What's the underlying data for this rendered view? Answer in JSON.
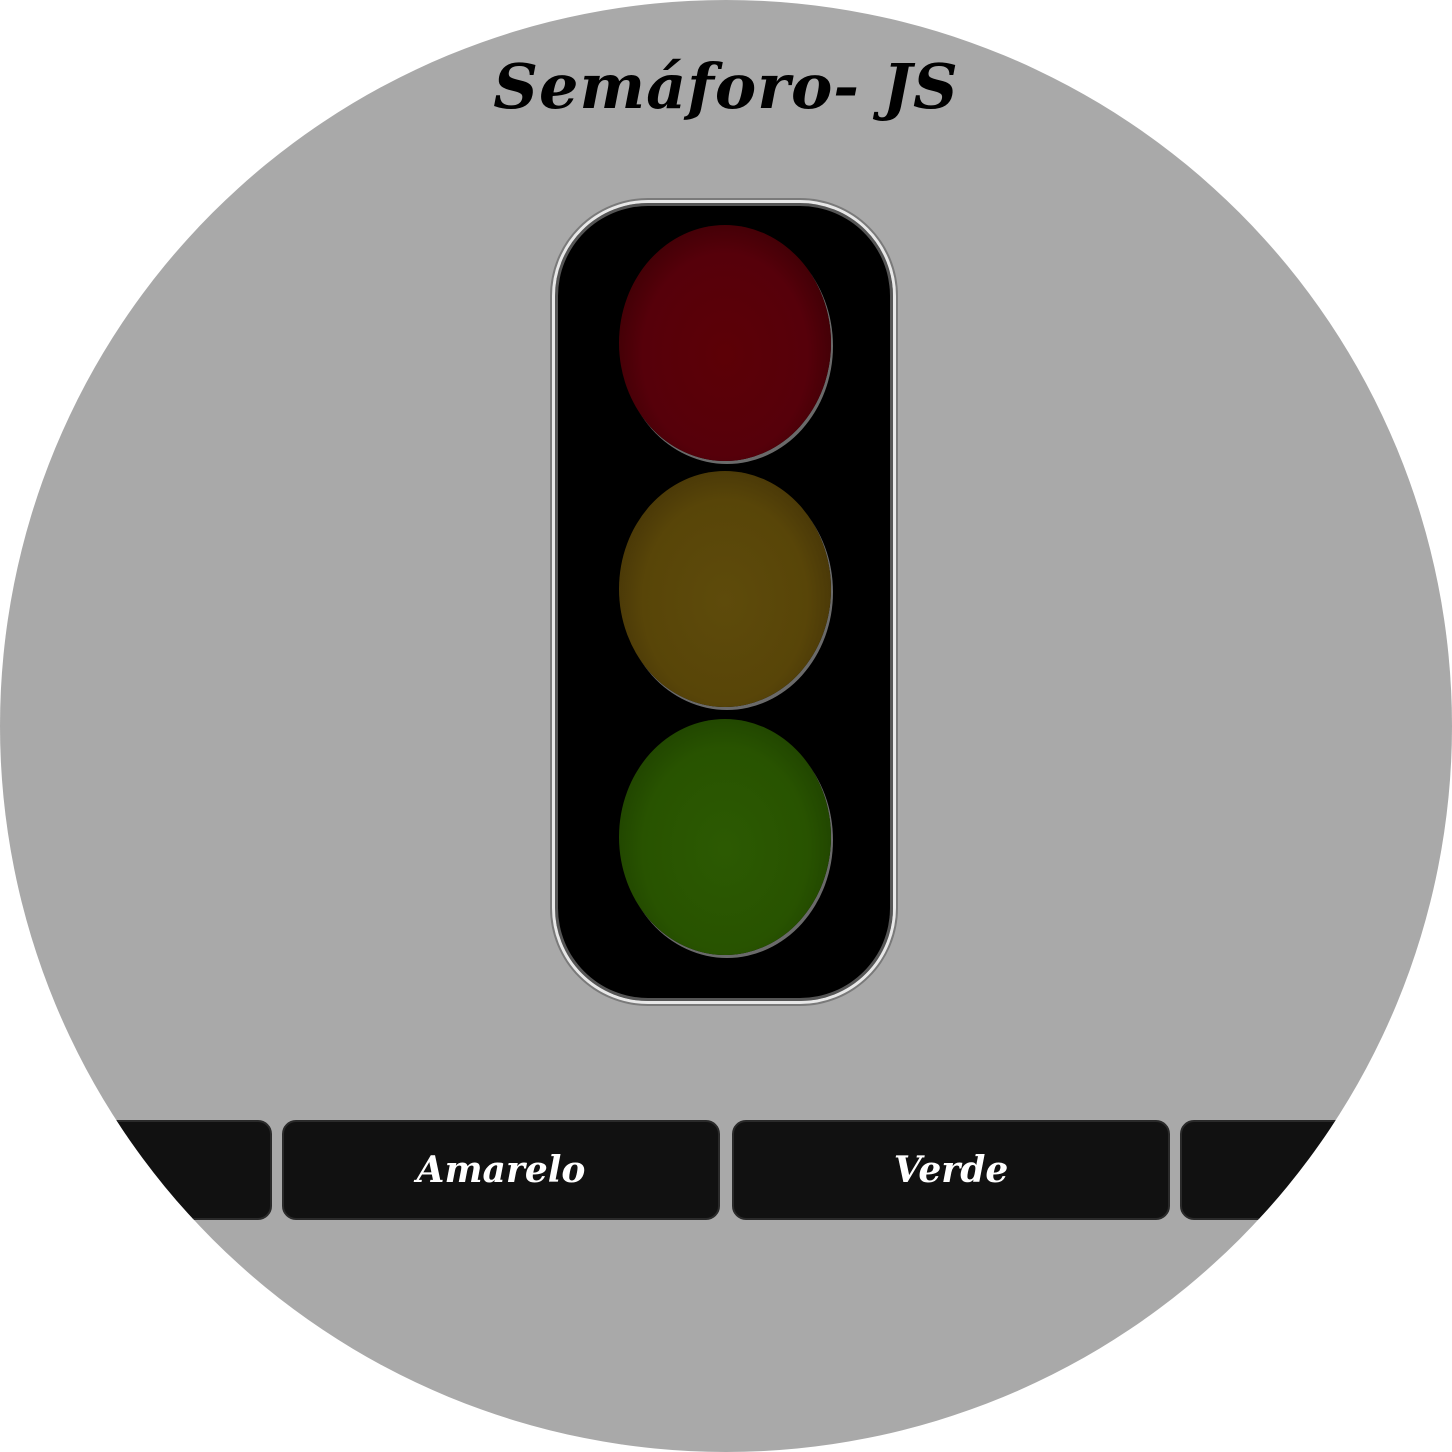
{
  "page": {
    "title": "Semáforo- JS"
  },
  "traffic_light": {
    "lamps": [
      {
        "name": "red",
        "color": "#5c0006",
        "state": "off"
      },
      {
        "name": "yellow",
        "color": "#5e4b0b",
        "state": "off"
      },
      {
        "name": "green",
        "color": "#2c5a02",
        "state": "off"
      }
    ]
  },
  "buttons": {
    "items": [
      {
        "label": ""
      },
      {
        "label": "Amarelo"
      },
      {
        "label": "Verde"
      },
      {
        "label": ""
      }
    ]
  },
  "colors": {
    "background_circle": "#a9a9a9",
    "button_bg": "#111111",
    "button_text": "#ffffff",
    "housing": "#000000"
  }
}
